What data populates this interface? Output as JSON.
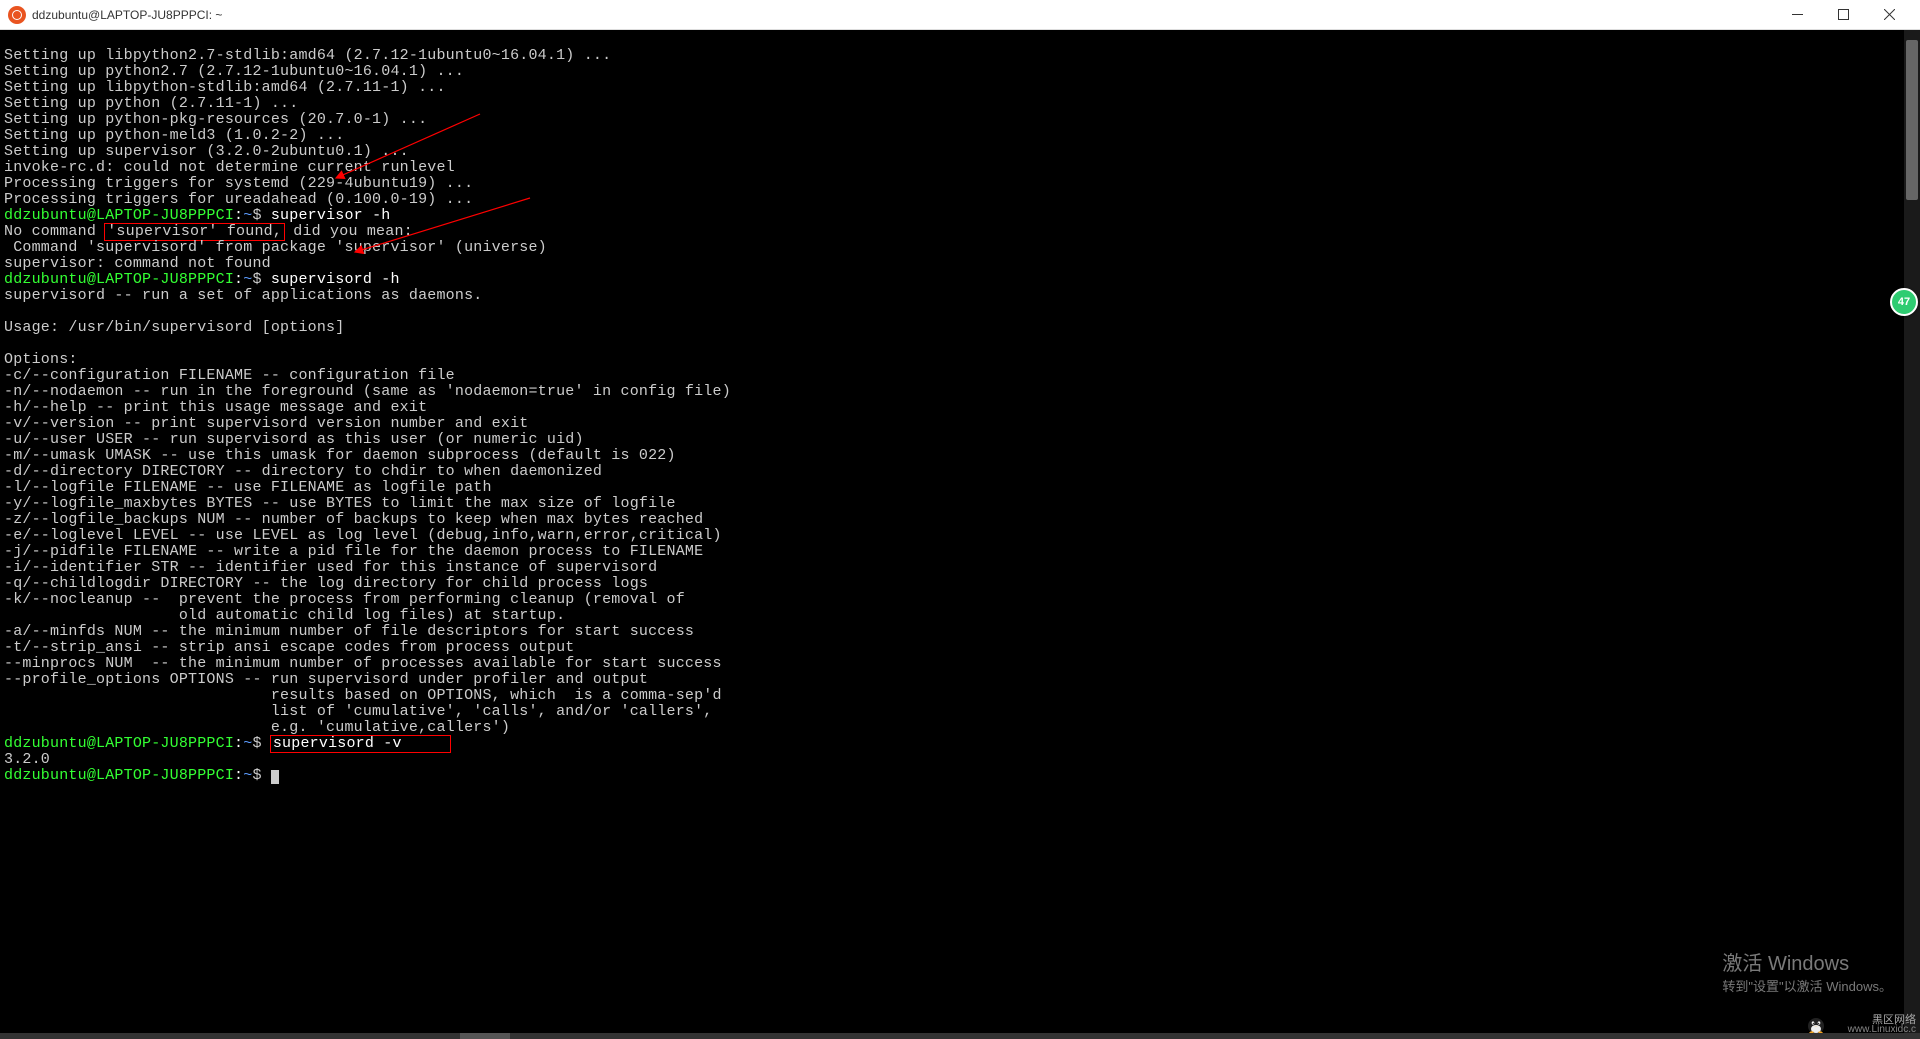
{
  "window": {
    "title": "ddzubuntu@LAPTOP-JU8PPPCI: ~"
  },
  "prompt": {
    "user_host": "ddzubuntu@LAPTOP-JU8PPPCI",
    "sep": ":",
    "path": "~",
    "sigil": "$"
  },
  "cmds": {
    "c1": "supervisor -h",
    "c2": "supervisord -h",
    "c3": "supervisord -v",
    "c4": ""
  },
  "lines": {
    "l01": "Setting up libpython2.7-stdlib:amd64 (2.7.12-1ubuntu0~16.04.1) ...",
    "l02": "Setting up python2.7 (2.7.12-1ubuntu0~16.04.1) ...",
    "l03": "Setting up libpython-stdlib:amd64 (2.7.11-1) ...",
    "l04": "Setting up python (2.7.11-1) ...",
    "l05": "Setting up python-pkg-resources (20.7.0-1) ...",
    "l06": "Setting up python-meld3 (1.0.2-2) ...",
    "l07": "Setting up supervisor (3.2.0-2ubuntu0.1) ...",
    "l08": "invoke-rc.d: could not determine current runlevel",
    "l09": "Processing triggers for systemd (229-4ubuntu19) ...",
    "l10": "Processing triggers for ureadahead (0.100.0-19) ...",
    "l11a": "No command ",
    "l11b": "'supervisor' found,",
    "l11c": " did you mean:",
    "l12": " Command 'supervisord' from package 'supervisor' (universe)",
    "l13": "supervisor: command not found",
    "l14": "supervisord -- run a set of applications as daemons.",
    "l15": "",
    "l16": "Usage: /usr/bin/supervisord [options]",
    "l17": "",
    "l18": "Options:",
    "l19": "-c/--configuration FILENAME -- configuration file",
    "l20": "-n/--nodaemon -- run in the foreground (same as 'nodaemon=true' in config file)",
    "l21": "-h/--help -- print this usage message and exit",
    "l22": "-v/--version -- print supervisord version number and exit",
    "l23": "-u/--user USER -- run supervisord as this user (or numeric uid)",
    "l24": "-m/--umask UMASK -- use this umask for daemon subprocess (default is 022)",
    "l25": "-d/--directory DIRECTORY -- directory to chdir to when daemonized",
    "l26": "-l/--logfile FILENAME -- use FILENAME as logfile path",
    "l27": "-y/--logfile_maxbytes BYTES -- use BYTES to limit the max size of logfile",
    "l28": "-z/--logfile_backups NUM -- number of backups to keep when max bytes reached",
    "l29": "-e/--loglevel LEVEL -- use LEVEL as log level (debug,info,warn,error,critical)",
    "l30": "-j/--pidfile FILENAME -- write a pid file for the daemon process to FILENAME",
    "l31": "-i/--identifier STR -- identifier used for this instance of supervisord",
    "l32": "-q/--childlogdir DIRECTORY -- the log directory for child process logs",
    "l33": "-k/--nocleanup --  prevent the process from performing cleanup (removal of",
    "l34": "                   old automatic child log files) at startup.",
    "l35": "-a/--minfds NUM -- the minimum number of file descriptors for start success",
    "l36": "-t/--strip_ansi -- strip ansi escape codes from process output",
    "l37": "--minprocs NUM  -- the minimum number of processes available for start success",
    "l38": "--profile_options OPTIONS -- run supervisord under profiler and output",
    "l39": "                             results based on OPTIONS, which  is a comma-sep'd",
    "l40": "                             list of 'cumulative', 'calls', and/or 'callers',",
    "l41": "                             e.g. 'cumulative,callers')",
    "l42": "3.2.0"
  },
  "badge": {
    "count": "47"
  },
  "watermark": {
    "l1": "激活 Windows",
    "l2": "转到\"设置\"以激活 Windows。"
  },
  "brand": {
    "top": "黑区网络",
    "url": "www.Linuxidc.c"
  }
}
